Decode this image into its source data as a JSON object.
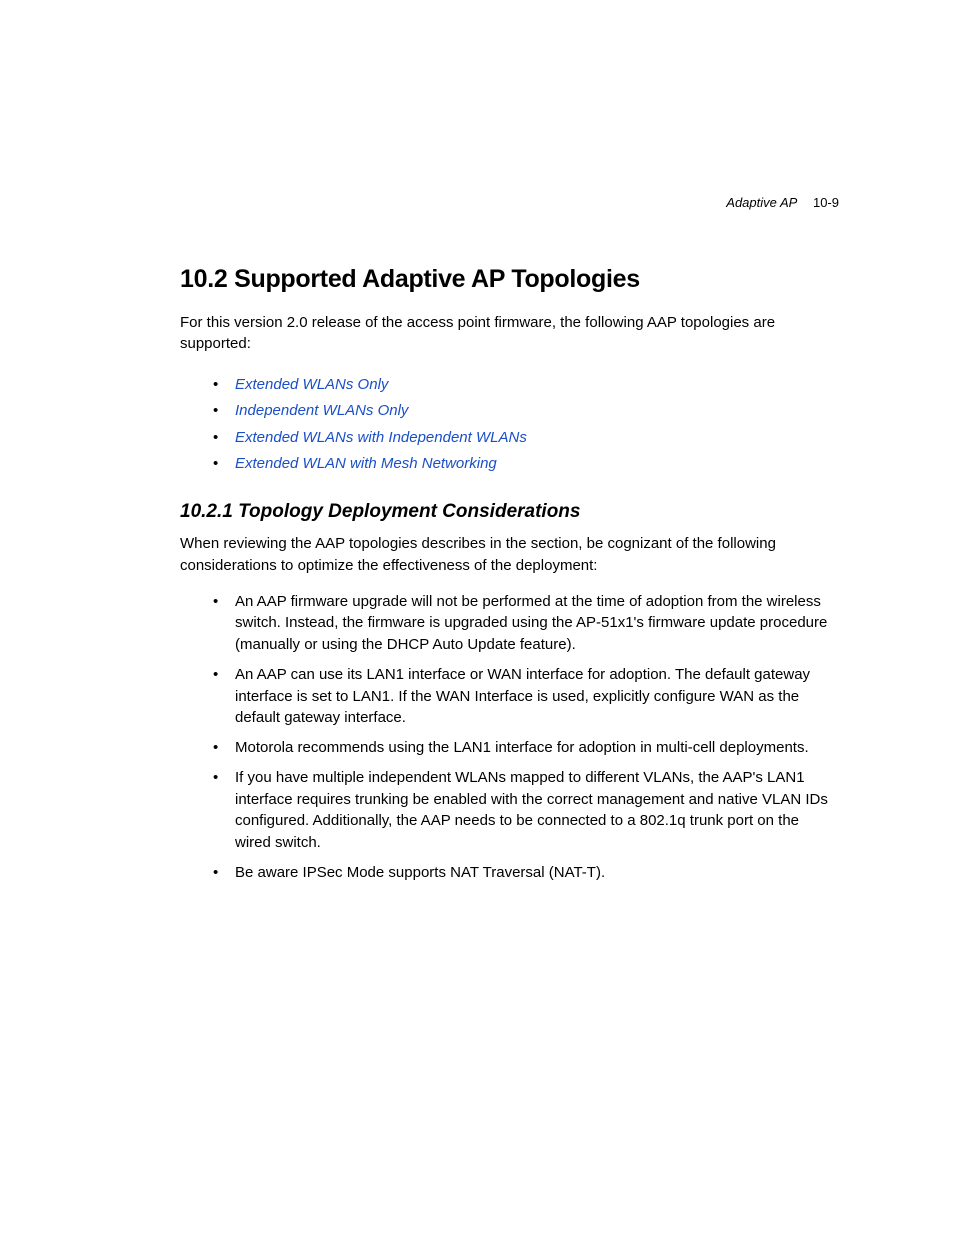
{
  "header": {
    "title": "Adaptive AP",
    "pageNumber": "10-9"
  },
  "section": {
    "heading": "10.2  Supported Adaptive AP Topologies",
    "intro": "For this version 2.0 release of the access point firmware, the following AAP topologies are supported:",
    "links": [
      "Extended WLANs Only",
      "Independent WLANs Only",
      "Extended WLANs with Independent WLANs",
      "Extended WLAN with Mesh Networking"
    ]
  },
  "subsection": {
    "heading": "10.2.1  Topology Deployment Considerations",
    "intro": "When reviewing the AAP topologies describes in the section, be cognizant of the following considerations to optimize the effectiveness of the deployment:",
    "bullets": [
      "An AAP firmware upgrade will not be performed at the time of adoption from the wireless switch. Instead, the firmware is upgraded using the AP-51x1's firmware update procedure (manually or using the DHCP Auto Update feature).",
      "An AAP can use its LAN1 interface or WAN interface for adoption. The default gateway interface is set to LAN1. If the WAN Interface is used, explicitly configure WAN as the default gateway interface.",
      "Motorola recommends using the LAN1 interface for adoption in multi-cell deployments.",
      "If you have multiple independent WLANs mapped to different VLANs, the AAP's LAN1 interface requires trunking be enabled with the correct management and native VLAN IDs configured. Additionally, the AAP needs to be connected to a 802.1q trunk port on the wired switch.",
      "Be aware IPSec Mode supports NAT Traversal (NAT-T)."
    ]
  }
}
